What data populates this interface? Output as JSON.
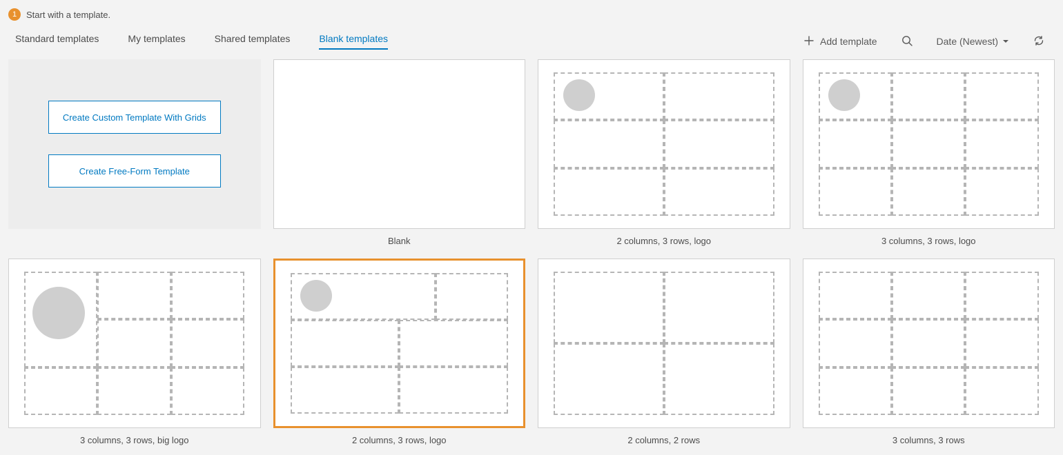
{
  "step": {
    "number": "1",
    "text": "Start with a template."
  },
  "tabs": {
    "items": [
      {
        "label": "Standard templates",
        "active": false
      },
      {
        "label": "My templates",
        "active": false
      },
      {
        "label": "Shared templates",
        "active": false
      },
      {
        "label": "Blank templates",
        "active": true
      }
    ]
  },
  "actions": {
    "add_label": "Add template",
    "add_icon": "plus-icon",
    "search_icon": "search-icon",
    "sort_label": "Date (Newest)",
    "sort_icon": "caret-down-icon",
    "refresh_icon": "refresh-icon"
  },
  "custom_card": {
    "btn_grids": "Create Custom Template With Grids",
    "btn_freeform": "Create Free-Form Template"
  },
  "templates": [
    {
      "id": "blank",
      "label": "Blank",
      "selected": false
    },
    {
      "id": "c2r3logo",
      "label": "2 columns, 3 rows, logo",
      "selected": false
    },
    {
      "id": "c3r3logo",
      "label": "3 columns, 3 rows, logo",
      "selected": false
    },
    {
      "id": "c3r3big",
      "label": "3 columns, 3 rows, big logo",
      "selected": false
    },
    {
      "id": "c2r3logo2",
      "label": "2 columns, 3 rows, logo",
      "selected": true
    },
    {
      "id": "c2r2",
      "label": "2 columns, 2 rows",
      "selected": false
    },
    {
      "id": "c3r3",
      "label": "3 columns, 3 rows",
      "selected": false
    }
  ]
}
